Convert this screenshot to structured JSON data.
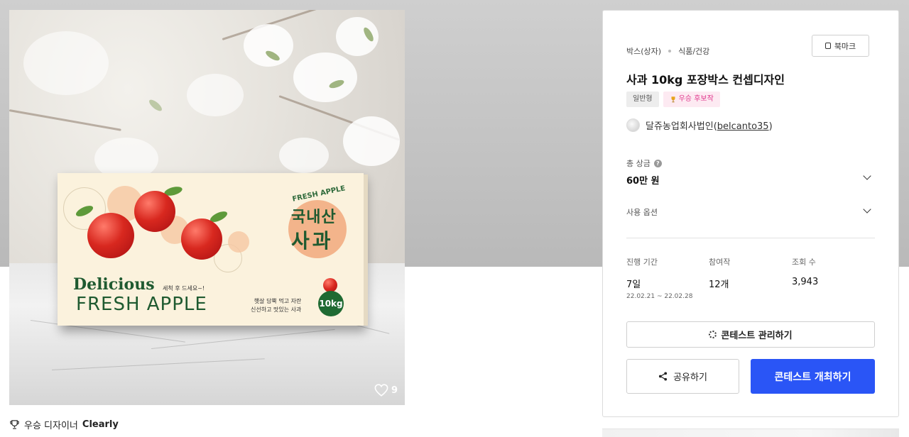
{
  "hero": {
    "like_count": "9",
    "box": {
      "fresh_apple_arc": "FRESH APPLE",
      "domestic": "국내산",
      "apple_kr": "사과",
      "delicious": "Delicious",
      "fresh_apple": "FRESH APPLE",
      "wash_note": "세척 후 드세요~!",
      "tagline_1": "햇살 담뿍 먹고 자란",
      "tagline_2": "신선하고 맛있는 사과",
      "weight": "10kg"
    }
  },
  "winner": {
    "prefix": "우승 디자이너",
    "name": "Clearly"
  },
  "panel": {
    "category": [
      "박스(상자)",
      "식품/건강"
    ],
    "bookmark_label": "북마크",
    "title": "사과 10kg 포장박스 컨셉디자인",
    "tags": {
      "type": "일반형",
      "award": "우승 후보작"
    },
    "owner": {
      "name": "달쥬농업회사법인",
      "id_open": "(",
      "id": "belcanto35",
      "id_close": ")"
    },
    "prize": {
      "label": "총 상금",
      "value": "60만 원"
    },
    "usage_label": "사용 옵션",
    "stats": {
      "period_label": "진행 기간",
      "period_value": "7일",
      "period_range": "22.02.21 ~ 22.02.28",
      "entries_label": "참여작",
      "entries_value": "12개",
      "views_label": "조회 수",
      "views_value": "3,943"
    },
    "manage_label": "콘테스트 관리하기",
    "share_label": "공유하기",
    "host_label": "콘테스트 개최하기"
  },
  "colors": {
    "primary": "#2a55f6",
    "award_pink": "#e0388d",
    "box_green": "#1f5a30"
  }
}
